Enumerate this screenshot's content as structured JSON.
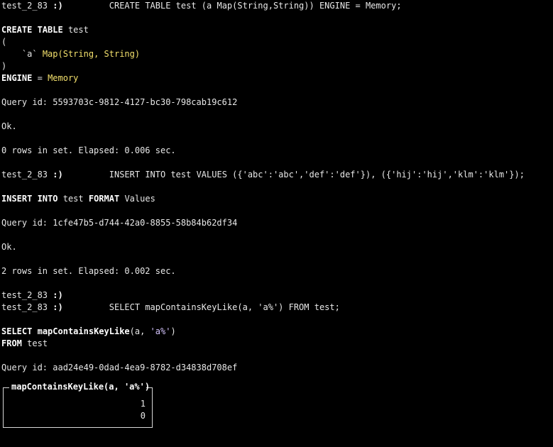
{
  "session": {
    "prompt_host": "test_2_83",
    "prompt_arrow": ":)"
  },
  "block1": {
    "input_query": "CREATE TABLE test (a Map(String,String)) ENGINE = Memory;",
    "fmt_create": "CREATE TABLE",
    "fmt_table": "test",
    "fmt_open_paren": "(",
    "fmt_col_name": "`a`",
    "fmt_col_type": "Map(String, String)",
    "fmt_close_paren": ")",
    "fmt_engine_kw": "ENGINE",
    "fmt_engine_eq": "=",
    "fmt_engine_val": "Memory",
    "query_id": "Query id: 5593703c-9812-4127-bc30-798cab19c612",
    "ok": "Ok.",
    "summary": "0 rows in set. Elapsed: 0.006 sec."
  },
  "block2": {
    "input_query": "INSERT INTO test VALUES ({'abc':'abc','def':'def'}), ({'hij':'hij','klm':'klm'});",
    "fmt_insert_kw": "INSERT INTO",
    "fmt_table": "test",
    "fmt_format_kw": "FORMAT",
    "fmt_format_val": "Values",
    "query_id": "Query id: 1cfe47b5-d744-42a0-8855-58b84b62df34",
    "ok": "Ok.",
    "summary": "2 rows in set. Elapsed: 0.002 sec."
  },
  "block3": {
    "input_query": "SELECT mapContainsKeyLike(a, 'a%') FROM test;",
    "fmt_select_kw": "SELECT",
    "fmt_fn": "mapContainsKeyLike",
    "fmt_args_open": "(a, ",
    "fmt_arg_str": "'a%'",
    "fmt_args_close": ")",
    "fmt_from_kw": "FROM",
    "fmt_table": "test",
    "query_id": "Query id: aad24e49-0dad-4ea9-8782-d34838d708ef",
    "result": {
      "column_header": "mapContainsKeyLike(a, 'a%')",
      "rows": [
        "1",
        "0"
      ]
    }
  },
  "colors": {
    "background": "#000000",
    "text": "#e8e8e8",
    "keyword": "#ffffff",
    "type": "#f3e06c",
    "string": "#d6c6ff"
  }
}
